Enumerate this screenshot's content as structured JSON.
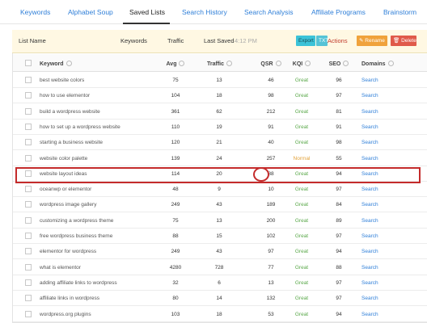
{
  "tabs": [
    {
      "label": "Keywords"
    },
    {
      "label": "Alphabet Soup"
    },
    {
      "label": "Saved Lists",
      "active": true
    },
    {
      "label": "Search History"
    },
    {
      "label": "Search Analysis"
    },
    {
      "label": "Affiliate Programs"
    },
    {
      "label": "Brainstorm"
    }
  ],
  "list_bar": {
    "list_name": "List Name",
    "keywords": "Keywords",
    "traffic": "Traffic",
    "last_saved": "Last Saved",
    "last_saved_value": "4:12 PM",
    "actions": "Actions",
    "export": "Export",
    "txt": "TXT",
    "rename": "Rename",
    "delete": "Delete"
  },
  "table": {
    "headers": {
      "keyword": "Keyword",
      "avg": "Avg",
      "traffic": "Traffic",
      "qsr": "QSR",
      "kqi": "KQI",
      "seo": "SEO",
      "domains": "Domains"
    },
    "rows": [
      {
        "keyword": "best website colors",
        "avg": "75",
        "traffic": "13",
        "qsr": "46",
        "kqi": "Great",
        "seo": "96",
        "domains": "Search"
      },
      {
        "keyword": "how to use elementor",
        "avg": "104",
        "traffic": "18",
        "qsr": "98",
        "kqi": "Great",
        "seo": "97",
        "domains": "Search"
      },
      {
        "keyword": "build a wordpress website",
        "avg": "361",
        "traffic": "62",
        "qsr": "212",
        "kqi": "Great",
        "seo": "81",
        "domains": "Search"
      },
      {
        "keyword": "how to set up a wordpress website",
        "avg": "110",
        "traffic": "19",
        "qsr": "91",
        "kqi": "Great",
        "seo": "91",
        "domains": "Search"
      },
      {
        "keyword": "starting a business website",
        "avg": "120",
        "traffic": "21",
        "qsr": "40",
        "kqi": "Great",
        "seo": "98",
        "domains": "Search"
      },
      {
        "keyword": "website color palette",
        "avg": "139",
        "traffic": "24",
        "qsr": "257",
        "kqi": "Normal",
        "seo": "55",
        "domains": "Search"
      },
      {
        "keyword": "website layout ideas",
        "avg": "114",
        "traffic": "20",
        "qsr": "88",
        "kqi": "Great",
        "seo": "94",
        "domains": "Search",
        "highlighted": true
      },
      {
        "keyword": "oceanwp or elementor",
        "avg": "48",
        "traffic": "9",
        "qsr": "10",
        "kqi": "Great",
        "seo": "97",
        "domains": "Search"
      },
      {
        "keyword": "wordpress image gallery",
        "avg": "249",
        "traffic": "43",
        "qsr": "189",
        "kqi": "Great",
        "seo": "84",
        "domains": "Search"
      },
      {
        "keyword": "customizing a wordpress theme",
        "avg": "75",
        "traffic": "13",
        "qsr": "200",
        "kqi": "Great",
        "seo": "89",
        "domains": "Search"
      },
      {
        "keyword": "free wordpress business theme",
        "avg": "88",
        "traffic": "15",
        "qsr": "102",
        "kqi": "Great",
        "seo": "97",
        "domains": "Search"
      },
      {
        "keyword": "elementor for wordpress",
        "avg": "249",
        "traffic": "43",
        "qsr": "97",
        "kqi": "Great",
        "seo": "94",
        "domains": "Search"
      },
      {
        "keyword": "what is elementor",
        "avg": "4280",
        "traffic": "728",
        "qsr": "77",
        "kqi": "Great",
        "seo": "88",
        "domains": "Search"
      },
      {
        "keyword": "adding affiliate links to wordpress",
        "avg": "32",
        "traffic": "6",
        "qsr": "13",
        "kqi": "Great",
        "seo": "97",
        "domains": "Search"
      },
      {
        "keyword": "affiliate links in wordpress",
        "avg": "80",
        "traffic": "14",
        "qsr": "132",
        "kqi": "Great",
        "seo": "97",
        "domains": "Search"
      },
      {
        "keyword": "wordpress.org plugins",
        "avg": "103",
        "traffic": "18",
        "qsr": "53",
        "kqi": "Great",
        "seo": "94",
        "domains": "Search"
      }
    ]
  },
  "colors": {
    "link": "#2f7fd8",
    "great": "#5aa84a",
    "normal": "#e2a23a",
    "highlight": "#c42b2b"
  }
}
